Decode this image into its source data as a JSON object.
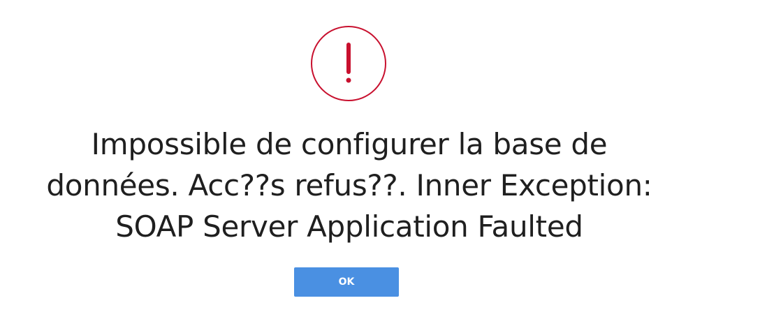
{
  "dialog": {
    "message_lines": [
      "Impossible de configurer la base de",
      "données. Acc??s refus??. Inner Exception:",
      "SOAP Server Application Faulted"
    ],
    "ok_label": "OK",
    "icon": "exclamation-circle-icon",
    "accent_color": "#c8102e",
    "button_color": "#4a90e2"
  }
}
